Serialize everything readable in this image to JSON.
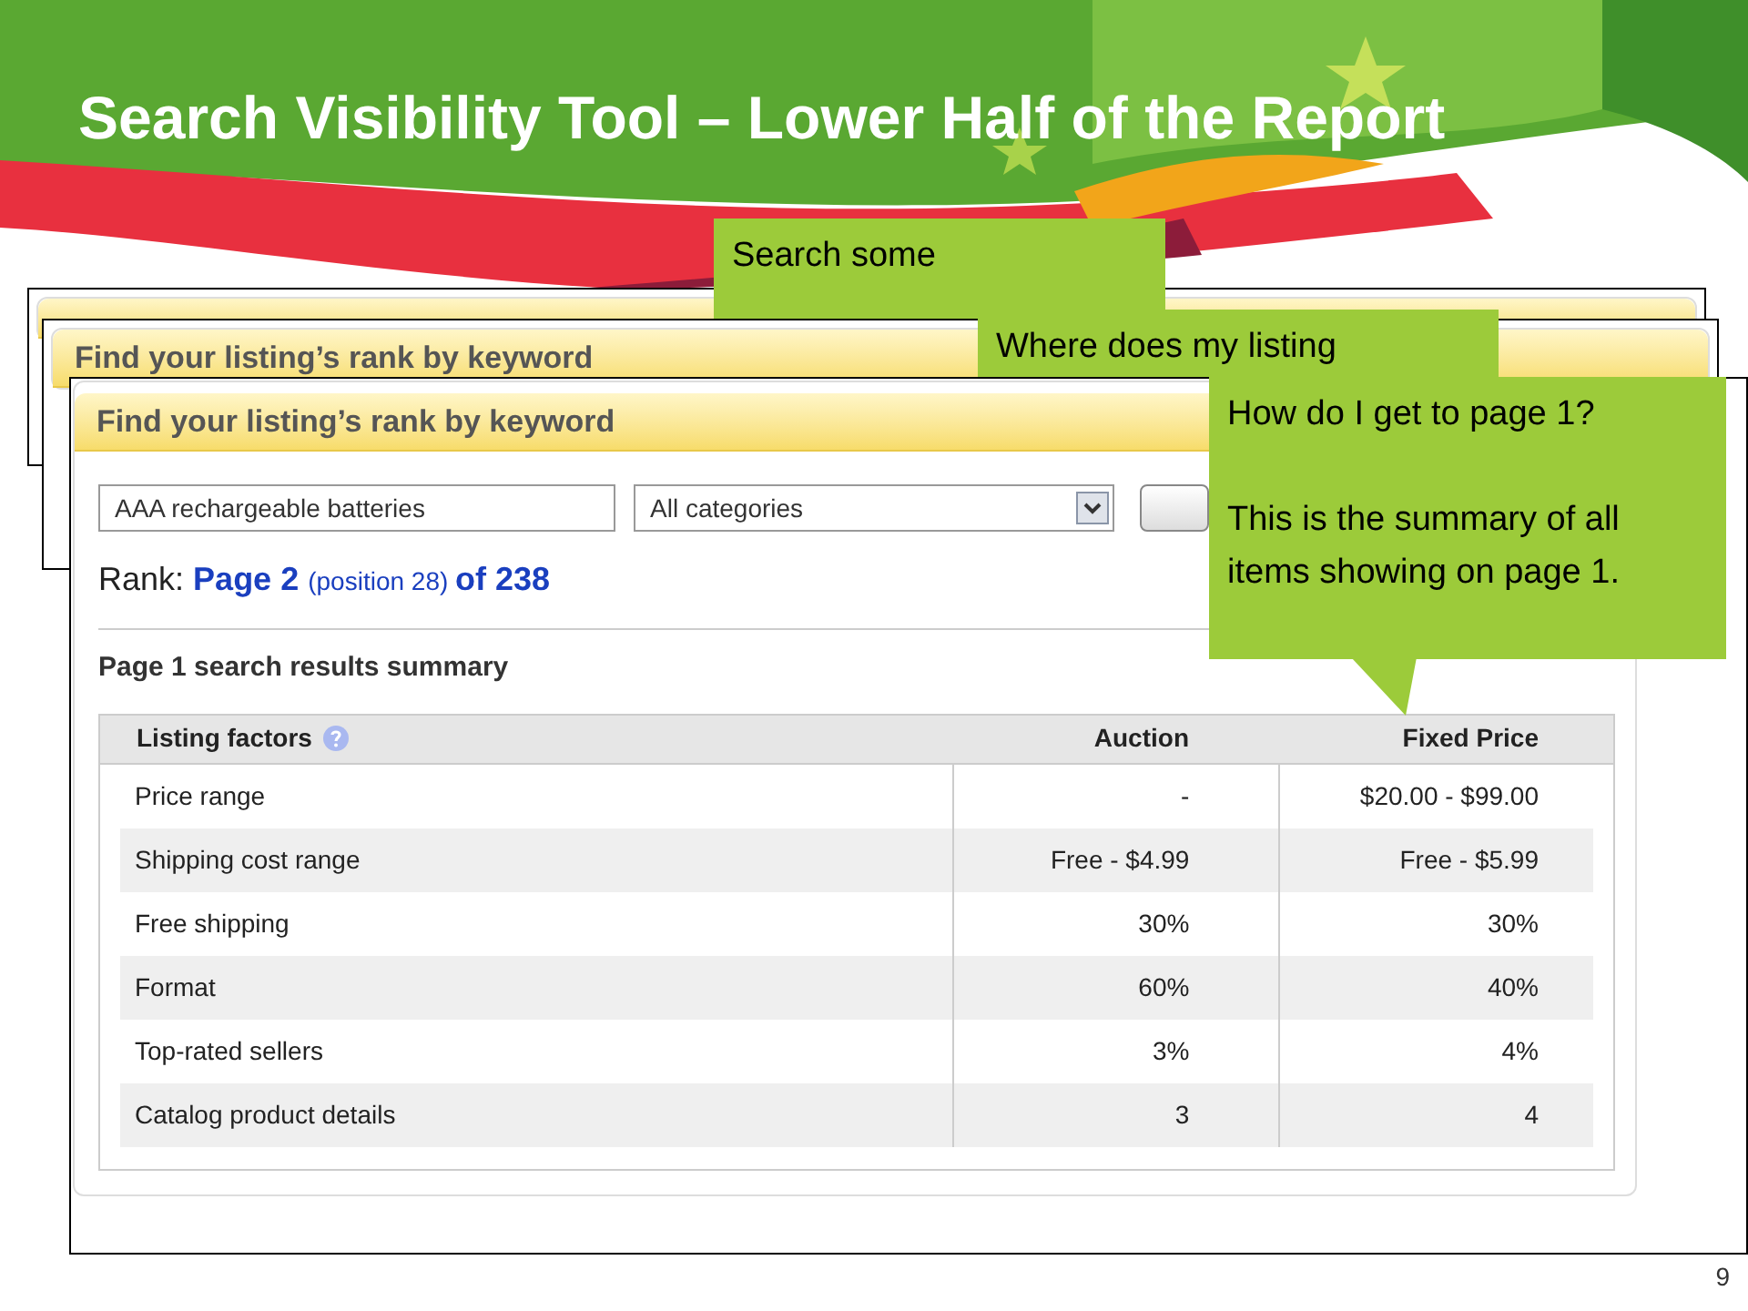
{
  "slide_title": "Search Visibility Tool – Lower Half of the Report",
  "stacked_panels": [
    {
      "kind": "blank"
    },
    {
      "kind": "titled",
      "header": "Find your listing’s rank by keyword"
    }
  ],
  "callouts": [
    {
      "kind": "plain",
      "lines": [
        "Search some"
      ]
    },
    {
      "kind": "plain",
      "lines": [
        "Where does my listing"
      ]
    },
    {
      "kind": "pointer",
      "lines": [
        "How do I get to page 1?",
        "This is the summary of all items showing on page 1."
      ]
    }
  ],
  "report": {
    "header": "Find your listing’s rank by keyword",
    "keyword_value": "AAA rechargeable batteries",
    "category_value": "All categories",
    "rank_label": "Rank:",
    "rank_page": "Page 2",
    "rank_position": "(position 28)",
    "rank_total": "of 238",
    "summary_title": "Page 1 search results summary",
    "columns": [
      "Listing factors",
      "Auction",
      "Fixed Price"
    ],
    "rows": [
      [
        "Price range",
        "-",
        "$20.00 - $99.00"
      ],
      [
        "Shipping cost range",
        "Free - $4.99",
        "Free - $5.99"
      ],
      [
        "Free shipping",
        "30%",
        "30%"
      ],
      [
        "Format",
        "60%",
        "40%"
      ],
      [
        "Top-rated sellers",
        "3%",
        "4%"
      ],
      [
        "Catalog product details",
        "3",
        "4"
      ]
    ]
  },
  "page_number": "9"
}
